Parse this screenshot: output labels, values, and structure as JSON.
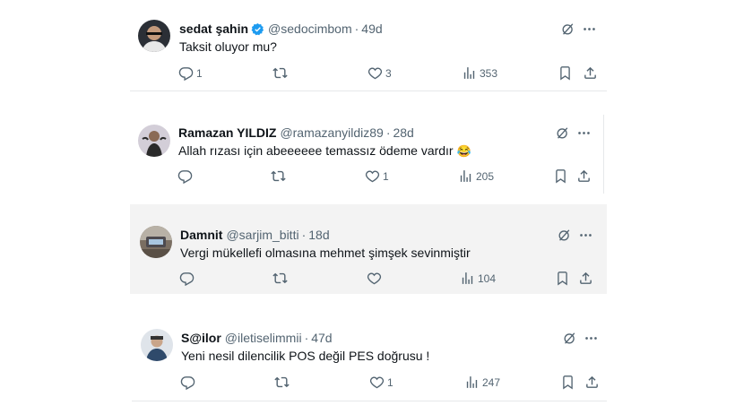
{
  "tweets": [
    {
      "name": "sedat şahin",
      "verified": true,
      "handle": "@sedocimbom",
      "time": "49d",
      "text": "Taksit oluyor mu?",
      "replies": "1",
      "retweets": "",
      "likes": "3",
      "views": "353",
      "avatar_color": "#2b2f36"
    },
    {
      "name": "Ramazan YILDIZ",
      "verified": false,
      "handle": "@ramazanyildiz89",
      "time": "28d",
      "text": "Allah rızası için abeeeeee temassız ödeme vardır",
      "emoji": "😂",
      "replies": "",
      "retweets": "",
      "likes": "1",
      "views": "205",
      "avatar_color": "#c9c3cf"
    },
    {
      "name": "Damnit",
      "verified": false,
      "handle": "@sarjim_bitti",
      "time": "18d",
      "text": "Vergi mükellefi olmasına mehmet şimşek sevinmiştir",
      "replies": "",
      "retweets": "",
      "likes": "",
      "views": "104",
      "avatar_color": "#6b6156"
    },
    {
      "name": "S@ilor",
      "verified": false,
      "handle": "@iletiselimmii",
      "time": "47d",
      "text": "Yeni nesil dilencilik POS değil PES doğrusu !",
      "replies": "",
      "retweets": "",
      "likes": "1",
      "views": "247",
      "avatar_color": "#3a4e66"
    }
  ],
  "separator": "·",
  "colors": {
    "text": "#0f1419",
    "muted": "#536471",
    "verified": "#1d9bf0"
  },
  "icons": [
    "reply-icon",
    "retweet-icon",
    "like-icon",
    "views-icon",
    "bookmark-icon",
    "share-icon",
    "grok-icon",
    "more-icon",
    "verified-badge-icon"
  ]
}
